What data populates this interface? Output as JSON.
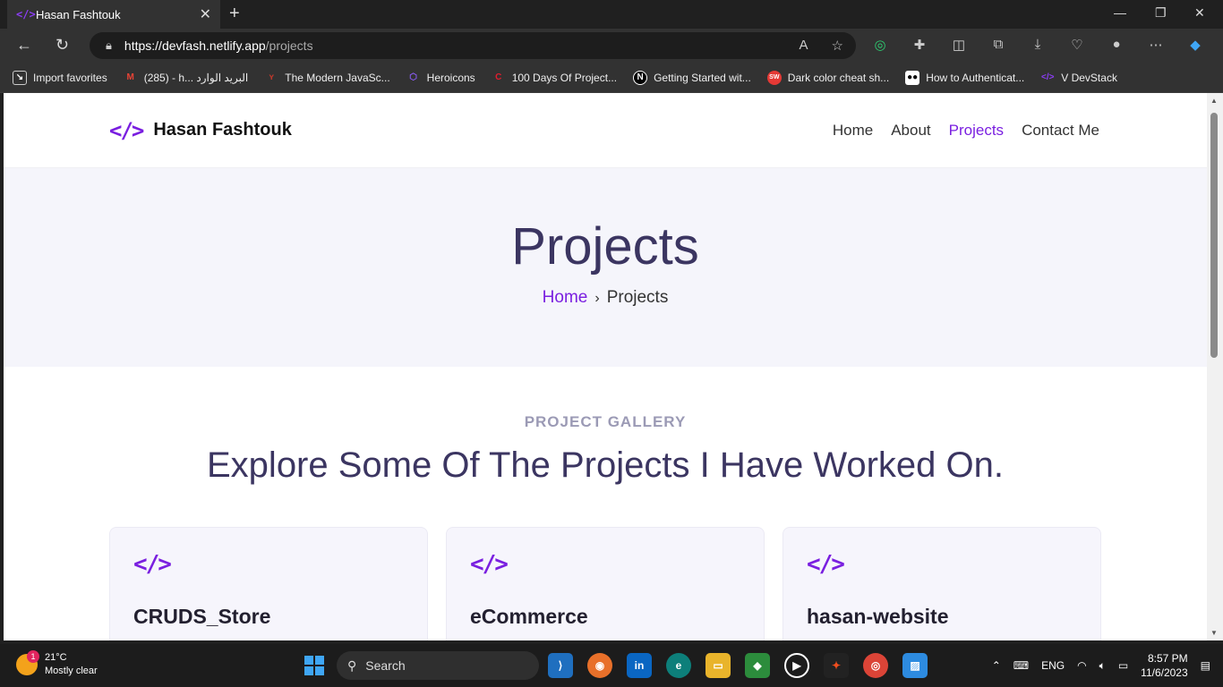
{
  "browser": {
    "tab_title": "Hasan Fashtouk",
    "tab_favicon": "</>",
    "new_tab": "+",
    "url_host": "https://devfash.netlify.app",
    "url_path": "/projects",
    "bookmarks": [
      {
        "label": "Import favorites",
        "icon": "import-icon",
        "color": "#555555"
      },
      {
        "label": "(285) - h... البريد الوارد",
        "icon": "gmail-icon",
        "color": "#d93025"
      },
      {
        "label": "The Modern JavaSc...",
        "icon": "javascript-info-icon",
        "color": "#c0392b"
      },
      {
        "label": "Heroicons",
        "icon": "heroicons-icon",
        "color": "#6b46c1"
      },
      {
        "label": "100 Days Of Project...",
        "icon": "codepen-icon",
        "color": "#d0021b"
      },
      {
        "label": "Getting Started wit...",
        "icon": "nextjs-icon",
        "color": "#000000"
      },
      {
        "label": "Dark color cheat sh...",
        "icon": "sw-icon",
        "color": "#e53935"
      },
      {
        "label": "How to Authenticat...",
        "icon": "medium-icon",
        "color": "#000000"
      },
      {
        "label": "V DevStack",
        "icon": "devstack-icon",
        "color": "#7a1fe0"
      }
    ]
  },
  "site": {
    "logo_icon": "</>",
    "logo_text": "Hasan Fashtouk",
    "nav": [
      {
        "label": "Home",
        "active": false
      },
      {
        "label": "About",
        "active": false
      },
      {
        "label": "Projects",
        "active": true
      },
      {
        "label": "Contact Me",
        "active": false
      }
    ],
    "hero_title": "Projects",
    "breadcrumb_home": "Home",
    "breadcrumb_sep": "›",
    "breadcrumb_current": "Projects",
    "gallery_eyebrow": "PROJECT GALLERY",
    "gallery_heading": "Explore Some Of The Projects I Have Worked On.",
    "cards": [
      {
        "icon": "</>",
        "name": "CRUDS_Store"
      },
      {
        "icon": "</>",
        "name": "eCommerce"
      },
      {
        "icon": "</>",
        "name": "hasan-website"
      }
    ],
    "accent_color": "#7a1fe0"
  },
  "taskbar": {
    "weather_badge": "1",
    "temperature": "21°C",
    "weather_desc": "Mostly clear",
    "search_label": "Search",
    "language": "ENG",
    "time": "8:57 PM",
    "date": "11/6/2023"
  }
}
